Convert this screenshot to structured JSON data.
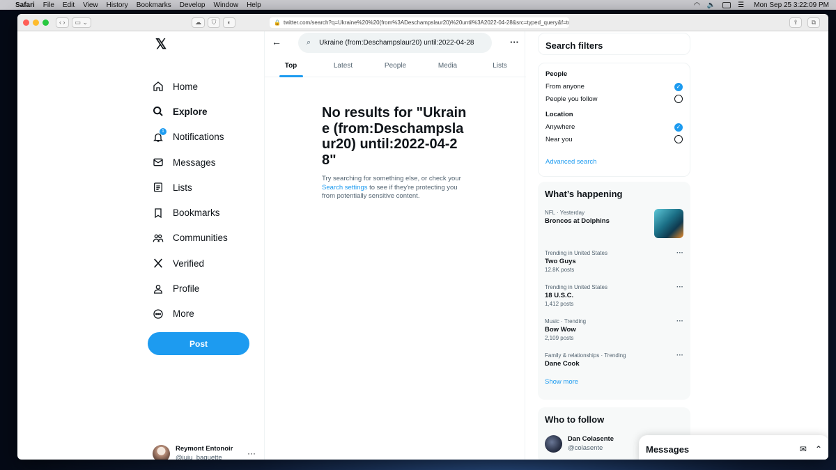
{
  "menubar": {
    "app": "Safari",
    "items": [
      "File",
      "Edit",
      "View",
      "History",
      "Bookmarks",
      "Develop",
      "Window",
      "Help"
    ],
    "clock": "Mon Sep 25  3:22:09 PM"
  },
  "browser": {
    "url": "twitter.com/search?q=Ukraine%20%20(from%3ADeschampslaur20)%20until%3A2022-04-28&src=typed_query&f=top"
  },
  "sidebar": {
    "items": [
      {
        "label": "Home",
        "icon": "home-icon"
      },
      {
        "label": "Explore",
        "icon": "search-icon",
        "active": true
      },
      {
        "label": "Notifications",
        "icon": "bell-icon",
        "badge": "1"
      },
      {
        "label": "Messages",
        "icon": "mail-icon"
      },
      {
        "label": "Lists",
        "icon": "list-icon"
      },
      {
        "label": "Bookmarks",
        "icon": "bookmark-icon"
      },
      {
        "label": "Communities",
        "icon": "people-icon"
      },
      {
        "label": "Verified",
        "icon": "x-logo-icon"
      },
      {
        "label": "Profile",
        "icon": "person-icon"
      },
      {
        "label": "More",
        "icon": "more-circle-icon"
      }
    ],
    "post_label": "Post",
    "account": {
      "name": "Reymont Entonoir",
      "handle": "@juju_baguette"
    }
  },
  "search": {
    "query": "Ukraine  (from:Deschampslaur20) until:2022-04-28",
    "tabs": [
      "Top",
      "Latest",
      "People",
      "Media",
      "Lists"
    ],
    "active_tab": "Top"
  },
  "results": {
    "title": "No results for \"Ukraine (from:Deschampslaur20) until:2022-04-28\"",
    "desc_before": "Try searching for something else, or check your ",
    "desc_link": "Search settings",
    "desc_after": " to see if they're protecting you from potentially sensitive content."
  },
  "filters": {
    "title": "Search filters",
    "people_heading": "People",
    "people_options": [
      {
        "label": "From anyone",
        "checked": true
      },
      {
        "label": "People you follow",
        "checked": false
      }
    ],
    "location_heading": "Location",
    "location_options": [
      {
        "label": "Anywhere",
        "checked": true
      },
      {
        "label": "Near you",
        "checked": false
      }
    ],
    "advanced": "Advanced search"
  },
  "trends": {
    "title": "What’s happening",
    "items": [
      {
        "meta": "NFL · Yesterday",
        "name": "Broncos at Dolphins",
        "count": "",
        "thumb": true
      },
      {
        "meta": "Trending in United States",
        "name": "Two Guys",
        "count": "12.8K posts"
      },
      {
        "meta": "Trending in United States",
        "name": "18 U.S.C.",
        "count": "1,412 posts"
      },
      {
        "meta": "Music · Trending",
        "name": "Bow Wow",
        "count": "2,109 posts"
      },
      {
        "meta": "Family & relationships · Trending",
        "name": "Dane Cook",
        "count": ""
      }
    ],
    "show_more": "Show more"
  },
  "follow": {
    "title": "Who to follow",
    "name": "Dan Colasente",
    "handle": "@colasente"
  },
  "messages_drawer": {
    "title": "Messages"
  },
  "colors": {
    "accent": "#1d9bf0",
    "text": "#0f1419",
    "muted": "#536471"
  }
}
